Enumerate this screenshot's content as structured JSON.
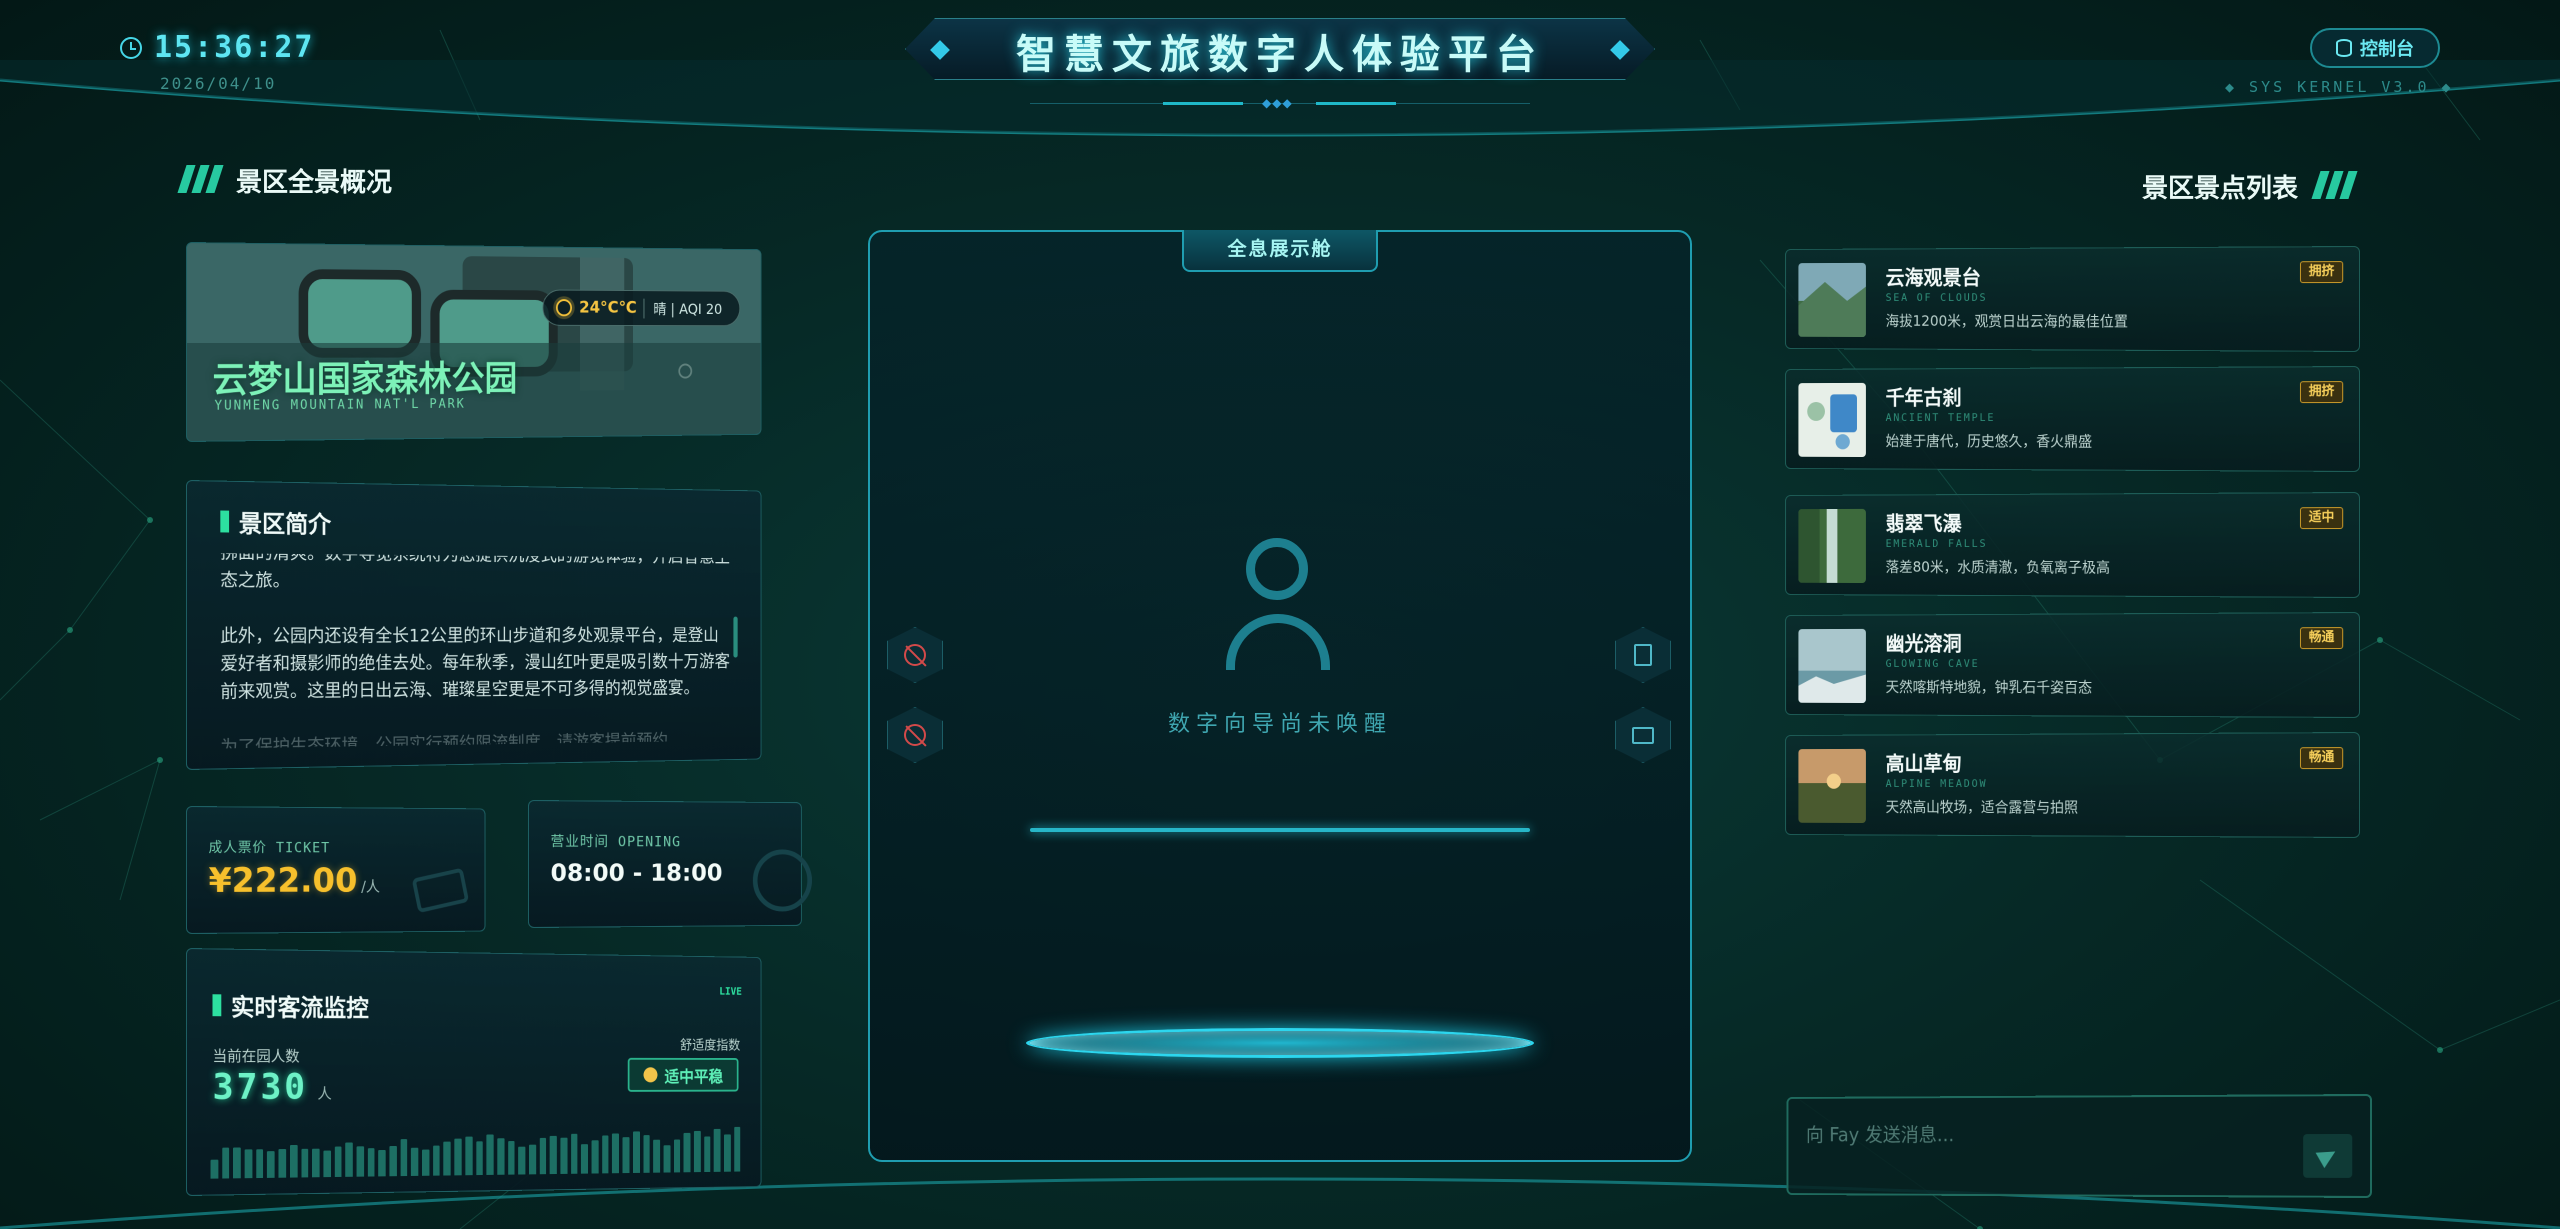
{
  "header": {
    "time": "15:36:27",
    "date": "2026/04/10",
    "title": "智慧文旅数字人体验平台",
    "control_label": "控制台",
    "kernel": "◆ SYS KERNEL V3.0 ◆"
  },
  "left": {
    "heading": "景区全景概况",
    "park": {
      "name": "云梦山国家森林公园",
      "name_en": "YUNMENG MOUNTAIN NAT'L PARK",
      "temperature": "24°C℃",
      "weather": "晴 | AQI 20"
    },
    "intro": {
      "heading": "景区简介",
      "paragraphs": [
        "拂面的清爽。数字导览系统将为您提供沉浸式的游览体验，开启智慧生态之旅。",
        "此外，公园内还设有全长12公里的环山步道和多处观景平台，是登山爱好者和摄影师的绝佳去处。每年秋季，漫山红叶更是吸引数十万游客前来观赏。这里的日出云海、璀璨星空更是不可多得的视觉盛宴。",
        "为了保护生态环境，公园实行预约限流制度，请游客提前预约。"
      ]
    },
    "ticket": {
      "label": "成人票价 TICKET",
      "price": "¥222.00",
      "unit": "/人"
    },
    "opening": {
      "label": "营业时间 OPENING",
      "hours": "08:00 - 18:00"
    },
    "flow": {
      "heading": "实时客流监控",
      "live": "LIVE",
      "current_label": "当前在园人数",
      "count": "3730",
      "count_unit": "人",
      "comfort_label": "舒适度指数",
      "comfort_value": "适中平稳",
      "trend": [
        18,
        30,
        30,
        28,
        28,
        26,
        28,
        32,
        28,
        28,
        26,
        30,
        34,
        30,
        28,
        26,
        30,
        36,
        28,
        26,
        30,
        34,
        36,
        38,
        34,
        40,
        36,
        34,
        28,
        30,
        36,
        38,
        36,
        40,
        30,
        34,
        38,
        40,
        36,
        42,
        38,
        34,
        28,
        34,
        40,
        42,
        36,
        44,
        38,
        46
      ]
    }
  },
  "center": {
    "tab": "全息展示舱",
    "status": "数字向导尚未唤醒"
  },
  "right": {
    "heading": "景区景点列表",
    "spots": [
      {
        "name": "云海观景台",
        "en": "SEA OF CLOUDS",
        "desc": "海拔1200米，观赏日出云海的最佳位置",
        "badge": "拥挤"
      },
      {
        "name": "千年古刹",
        "en": "ANCIENT TEMPLE",
        "desc": "始建于唐代，历史悠久，香火鼎盛",
        "badge": "拥挤"
      },
      {
        "name": "翡翠飞瀑",
        "en": "EMERALD FALLS",
        "desc": "落差80米，水质清澈，负氧离子极高",
        "badge": "适中"
      },
      {
        "name": "幽光溶洞",
        "en": "GLOWING CAVE",
        "desc": "天然喀斯特地貌，钟乳石千姿百态",
        "badge": "畅通"
      },
      {
        "name": "高山草甸",
        "en": "ALPINE MEADOW",
        "desc": "天然高山牧场，适合露营与拍照",
        "badge": "畅通"
      }
    ],
    "message_placeholder": "向 Fay 发送消息..."
  }
}
